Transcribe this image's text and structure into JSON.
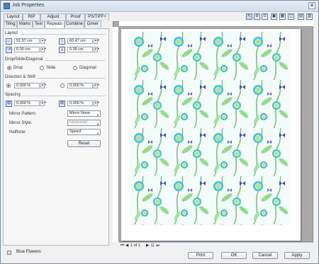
{
  "window": {
    "title": "Job Properties",
    "close_glyph": "✕"
  },
  "tabs_row1": [
    "Layout",
    "RIP",
    "Adjust",
    "Proof",
    "PS/TIFF+"
  ],
  "tabs_row2": [
    "Tiling",
    "Marks",
    "Text",
    "Repeats",
    "Combine",
    "Driver"
  ],
  "active_tab": "Repeats",
  "layout": {
    "heading": "Layout",
    "width": "51.97 cm",
    "height": "60.47 cm",
    "offset_x": "0.00 cm",
    "offset_y": "0.00 cm"
  },
  "drop": {
    "heading": "Drop/Slide/Diagonal",
    "options": [
      "Drop",
      "Slide",
      "Diagonal"
    ],
    "selected": "Drop"
  },
  "direction": {
    "heading": "Direction & Shift",
    "shift_a": "0.000 %",
    "shift_b": "0.000 %"
  },
  "spacing": {
    "heading": "Spacing",
    "h": "0.000 %",
    "v": "0.000 %"
  },
  "mirror_pattern": {
    "label": "Mirror Pattern:",
    "value": "Mirror None"
  },
  "mirror_style": {
    "label": "Mirror Style:",
    "value": "Horizontal"
  },
  "halftone": {
    "label": "Halftone:",
    "value": "Speed"
  },
  "reset_label": "Reset",
  "status_file": "Blue Flowers",
  "nav": {
    "page": "1 of 1"
  },
  "buttons": {
    "print": "Print",
    "ok": "OK",
    "cancel": "Cancel",
    "apply": "Apply"
  },
  "colors": {
    "accent": "#4a7cc0",
    "bg": "#f0f0f0",
    "preview_bg": "#a9a9a9",
    "pattern_leaf": "#7fcf77",
    "pattern_flower": "#33c6c9",
    "butterfly": "#3f4fae"
  }
}
